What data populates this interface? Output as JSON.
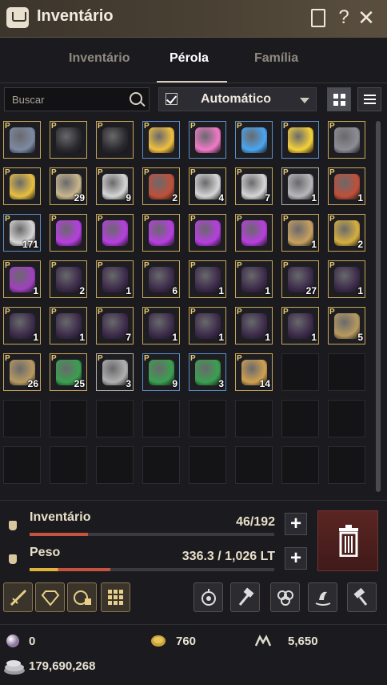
{
  "window": {
    "title": "Inventário",
    "buttons": [
      "doc",
      "help",
      "close"
    ],
    "help_glyph": "?",
    "close_glyph": "✕"
  },
  "tabs": [
    {
      "label": "Inventário",
      "active": false
    },
    {
      "label": "Pérola",
      "active": true
    },
    {
      "label": "Família",
      "active": false
    }
  ],
  "search": {
    "placeholder": "Buscar"
  },
  "sort": {
    "checked": true,
    "label": "Automático"
  },
  "grid": {
    "columns": 8,
    "rows": 8,
    "items": [
      {
        "art": "armor-helm-icon",
        "c": "#7d8aa3",
        "qty": ""
      },
      {
        "art": "black-hat-icon",
        "c": "#2a2a2e",
        "qty": ""
      },
      {
        "art": "black-hat-icon",
        "c": "#2a2a2e",
        "qty": ""
      },
      {
        "art": "balloon-bundle-icon",
        "c": "#f0c040",
        "qty": "",
        "frame": "blue"
      },
      {
        "art": "pink-balloon-icon",
        "c": "#f07ac8",
        "qty": "",
        "frame": "blue"
      },
      {
        "art": "blue-balloon-icon",
        "c": "#4aa6f0",
        "qty": "",
        "frame": "blue"
      },
      {
        "art": "yellow-balloon-icon",
        "c": "#f5d23a",
        "qty": "",
        "frame": "blue"
      },
      {
        "art": "wand-icon",
        "c": "#8d8d95",
        "qty": ""
      },
      {
        "art": "star-wand-icon",
        "c": "#e8c040",
        "qty": ""
      },
      {
        "art": "scroll-map-icon",
        "c": "#c9b68c",
        "qty": "29"
      },
      {
        "art": "coupon-icon",
        "c": "#d6d6d6",
        "qty": "9"
      },
      {
        "art": "red-box-icon",
        "c": "#c0503a",
        "qty": "2"
      },
      {
        "art": "coupon-icon",
        "c": "#d6d6d6",
        "qty": "4"
      },
      {
        "art": "coupon-icon",
        "c": "#d6d6d6",
        "qty": "7"
      },
      {
        "art": "silver-tree-icon",
        "c": "#b8b8bc",
        "qty": "1",
        "frame": "gray"
      },
      {
        "art": "red-box-icon",
        "c": "#c0503a",
        "qty": "1"
      },
      {
        "art": "coupon-icon",
        "c": "#d6d6d6",
        "qty": "171",
        "frame": "blue"
      },
      {
        "art": "purple-gift-icon",
        "c": "#b83ee0",
        "qty": ""
      },
      {
        "art": "purple-gift-icon",
        "c": "#b83ee0",
        "qty": ""
      },
      {
        "art": "purple-gift-icon",
        "c": "#b83ee0",
        "qty": ""
      },
      {
        "art": "purple-gift-icon",
        "c": "#b83ee0",
        "qty": ""
      },
      {
        "art": "purple-gift-icon",
        "c": "#b83ee0",
        "qty": ""
      },
      {
        "art": "ticket-icon",
        "c": "#c8a060",
        "qty": "1"
      },
      {
        "art": "butterfly-coin-icon",
        "c": "#d6b040",
        "qty": "2"
      },
      {
        "art": "treasure-chest-icon",
        "c": "#a040c0",
        "qty": "1"
      },
      {
        "art": "dark-banner-icon",
        "c": "#3c2a4a",
        "qty": "2"
      },
      {
        "art": "dark-banner-icon",
        "c": "#3c2a4a",
        "qty": "1"
      },
      {
        "art": "dark-banner-icon",
        "c": "#3c2a4a",
        "qty": "6"
      },
      {
        "art": "dark-banner-icon",
        "c": "#3c2a4a",
        "qty": "1"
      },
      {
        "art": "dark-banner-icon",
        "c": "#3c2a4a",
        "qty": "1"
      },
      {
        "art": "dark-banner-icon",
        "c": "#3c2a4a",
        "qty": "27"
      },
      {
        "art": "dark-banner-icon",
        "c": "#3c2a4a",
        "qty": "1"
      },
      {
        "art": "dark-banner-icon",
        "c": "#3c2a4a",
        "qty": "1"
      },
      {
        "art": "dark-banner-icon",
        "c": "#3c2a4a",
        "qty": "1"
      },
      {
        "art": "dark-banner-icon",
        "c": "#3c2a4a",
        "qty": "7"
      },
      {
        "art": "dark-banner-icon",
        "c": "#3c2a4a",
        "qty": "1"
      },
      {
        "art": "dark-banner-icon",
        "c": "#3c2a4a",
        "qty": "1"
      },
      {
        "art": "dark-banner-icon",
        "c": "#3c2a4a",
        "qty": "1"
      },
      {
        "art": "dark-banner-icon",
        "c": "#3c2a4a",
        "qty": "1"
      },
      {
        "art": "lantern-icon",
        "c": "#b89a60",
        "qty": "5"
      },
      {
        "art": "lantern-icon",
        "c": "#b89a60",
        "qty": "26"
      },
      {
        "art": "green-elixir-icon",
        "c": "#3aa050",
        "qty": "25"
      },
      {
        "art": "feather-icon",
        "c": "#b0b0b0",
        "qty": "3",
        "frame": "gray"
      },
      {
        "art": "green-elixir-icon",
        "c": "#3aa050",
        "qty": "9",
        "frame": "blue"
      },
      {
        "art": "green-elixir-icon",
        "c": "#3aa050",
        "qty": "3",
        "frame": "blue"
      },
      {
        "art": "scroll-book-icon",
        "c": "#d0a050",
        "qty": "14"
      }
    ]
  },
  "inventory": {
    "label": "Inventário",
    "value": "46/192",
    "fill": 0.24,
    "color": "#c9523f"
  },
  "weight": {
    "label": "Peso",
    "value": "336.3 / 1,026 LT",
    "fill": 0.33,
    "color_a": "#e2b23a",
    "color_b": "#c9523f"
  },
  "toolbar": {
    "left": [
      "sword-enhance-icon",
      "gem-icon",
      "alchemy-icon",
      "grid-craft-icon"
    ],
    "right": [
      "compass-icon",
      "hammer-icon",
      "knot-icon",
      "fishing-icon",
      "repair-hammer-icon"
    ]
  },
  "currency": {
    "pearl": "0",
    "coin": "760",
    "mileage": "5,650",
    "silver": "179,690,268"
  }
}
